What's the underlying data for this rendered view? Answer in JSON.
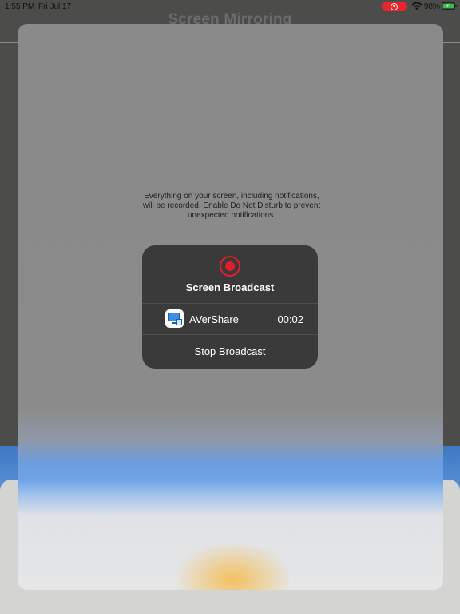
{
  "status_bar": {
    "time": "1:55 PM",
    "date": "Fri Jul 17",
    "battery_percent": "98%",
    "battery_level": 0.98,
    "charging": true,
    "recording_color": "#e8252c"
  },
  "background_app": {
    "title": "Screen Mirroring"
  },
  "notice": "Everything on your screen, including notifications, will be recorded. Enable Do Not Disturb to prevent unexpected notifications.",
  "broadcast": {
    "icon": "record-icon",
    "title": "Screen Broadcast",
    "app_icon": "aver-share-app-icon",
    "app_name": "AVerShare",
    "elapsed": "00:02",
    "stop_label": "Stop Broadcast",
    "accent_color": "#e21e2a"
  }
}
